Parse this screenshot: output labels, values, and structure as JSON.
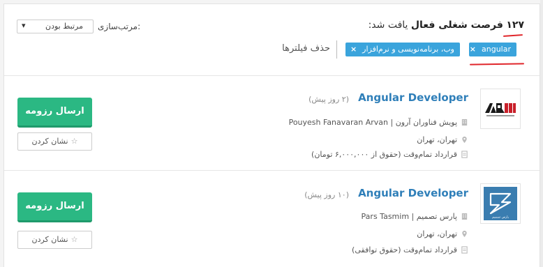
{
  "results": {
    "count": "۱۲۷",
    "active_label": "فرصت شغلی فعال",
    "found_label": "یافت شد:"
  },
  "sort": {
    "label": "مرتب‌سازی:",
    "value": "مرتبط بودن"
  },
  "filters": {
    "chips": [
      {
        "label": "angular"
      },
      {
        "label": "وب، برنامه‌نویسی و نرم‌افزار"
      }
    ],
    "clear_label": "حذف فیلترها"
  },
  "jobs": [
    {
      "title": "Angular Developer",
      "age": "(۲ روز پیش)",
      "company": "پویش فناوران آرون | Pouyesh Fanavaran Arvan",
      "location": "تهران، تهران",
      "contract": "قرارداد تمام‌وقت (حقوق از ۶,۰۰۰,۰۰۰ تومان)",
      "logo_text": "ARVAN"
    },
    {
      "title": "Angular Developer",
      "age": "(۱۰ روز پیش)",
      "company": "پارس تصمیم | Pars Tasmim",
      "location": "تهران، تهران",
      "contract": "قرارداد تمام‌وقت (حقوق توافقی)",
      "logo_text": "پارس تصمیم"
    }
  ],
  "actions": {
    "apply_label": "ارسال رزومه",
    "mark_label": "نشان کردن"
  },
  "colors": {
    "accent_blue": "#3aa4dc",
    "title_blue": "#2f7fb9",
    "apply_green": "#2bb883",
    "annotation_red": "#e0262b"
  }
}
